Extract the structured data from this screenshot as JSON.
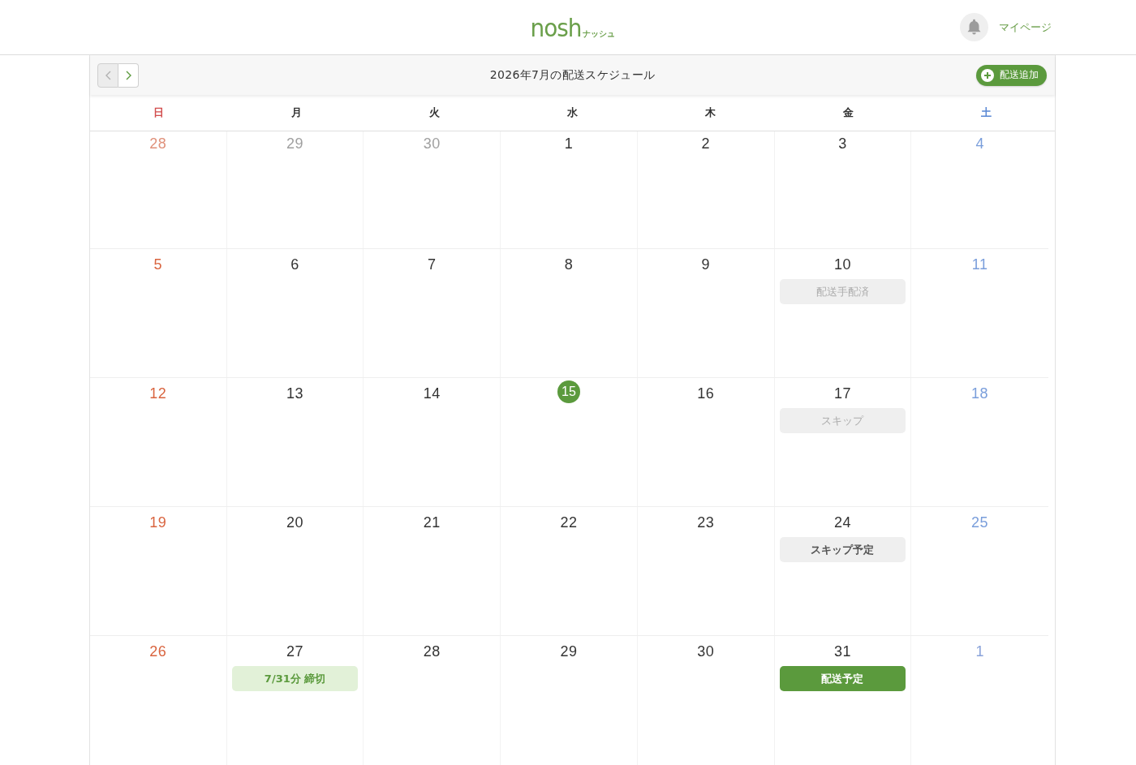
{
  "header": {
    "logo": {
      "wordmark": "nosh",
      "reading": "ナッシュ"
    },
    "mypage_link": "マイページ"
  },
  "calendar": {
    "nav": [
      {
        "kind": "prev",
        "disabled": true
      },
      {
        "kind": "next",
        "disabled": false
      }
    ],
    "title": "2026年7月の配送スケジュール",
    "add_button": "配送追加",
    "weekdays": [
      {
        "label": "日",
        "kind": "sunday"
      },
      {
        "label": "月",
        "kind": "weekday"
      },
      {
        "label": "火",
        "kind": "weekday"
      },
      {
        "label": "水",
        "kind": "weekday"
      },
      {
        "label": "木",
        "kind": "weekday"
      },
      {
        "label": "金",
        "kind": "weekday"
      },
      {
        "label": "土",
        "kind": "saturday"
      }
    ],
    "weeks": [
      {
        "days": [
          {
            "date": "28",
            "in_month": false,
            "today": false
          },
          {
            "date": "29",
            "in_month": false,
            "today": false
          },
          {
            "date": "30",
            "in_month": false,
            "today": false
          },
          {
            "date": "1",
            "in_month": true,
            "today": false
          },
          {
            "date": "2",
            "in_month": true,
            "today": false
          },
          {
            "date": "3",
            "in_month": true,
            "today": false
          },
          {
            "date": "4",
            "in_month": true,
            "today": false
          }
        ]
      },
      {
        "days": [
          {
            "date": "5",
            "in_month": true,
            "today": false
          },
          {
            "date": "6",
            "in_month": true,
            "today": false
          },
          {
            "date": "7",
            "in_month": true,
            "today": false
          },
          {
            "date": "8",
            "in_month": true,
            "today": false
          },
          {
            "date": "9",
            "in_month": true,
            "today": false
          },
          {
            "date": "10",
            "in_month": true,
            "today": false,
            "events": [
              {
                "label": "配送手配済",
                "kind": "arranged"
              }
            ]
          },
          {
            "date": "11",
            "in_month": true,
            "today": false
          }
        ]
      },
      {
        "days": [
          {
            "date": "12",
            "in_month": true,
            "today": false
          },
          {
            "date": "13",
            "in_month": true,
            "today": false
          },
          {
            "date": "14",
            "in_month": true,
            "today": false
          },
          {
            "date": "15",
            "in_month": true,
            "today": true
          },
          {
            "date": "16",
            "in_month": true,
            "today": false
          },
          {
            "date": "17",
            "in_month": true,
            "today": false,
            "events": [
              {
                "label": "スキップ",
                "kind": "skipped"
              }
            ]
          },
          {
            "date": "18",
            "in_month": true,
            "today": false
          }
        ]
      },
      {
        "days": [
          {
            "date": "19",
            "in_month": true,
            "today": false
          },
          {
            "date": "20",
            "in_month": true,
            "today": false
          },
          {
            "date": "21",
            "in_month": true,
            "today": false
          },
          {
            "date": "22",
            "in_month": true,
            "today": false
          },
          {
            "date": "23",
            "in_month": true,
            "today": false
          },
          {
            "date": "24",
            "in_month": true,
            "today": false,
            "events": [
              {
                "label": "スキップ予定",
                "kind": "skip_planned"
              }
            ]
          },
          {
            "date": "25",
            "in_month": true,
            "today": false
          }
        ]
      },
      {
        "days": [
          {
            "date": "26",
            "in_month": true,
            "today": false
          },
          {
            "date": "27",
            "in_month": true,
            "today": false,
            "events": [
              {
                "label": "7/31分 締切",
                "kind": "deadline"
              }
            ]
          },
          {
            "date": "28",
            "in_month": true,
            "today": false
          },
          {
            "date": "29",
            "in_month": true,
            "today": false
          },
          {
            "date": "30",
            "in_month": true,
            "today": false
          },
          {
            "date": "31",
            "in_month": true,
            "today": false,
            "events": [
              {
                "label": "配送予定",
                "kind": "delivery"
              }
            ]
          },
          {
            "date": "1",
            "in_month": false,
            "today": false
          }
        ]
      }
    ]
  }
}
